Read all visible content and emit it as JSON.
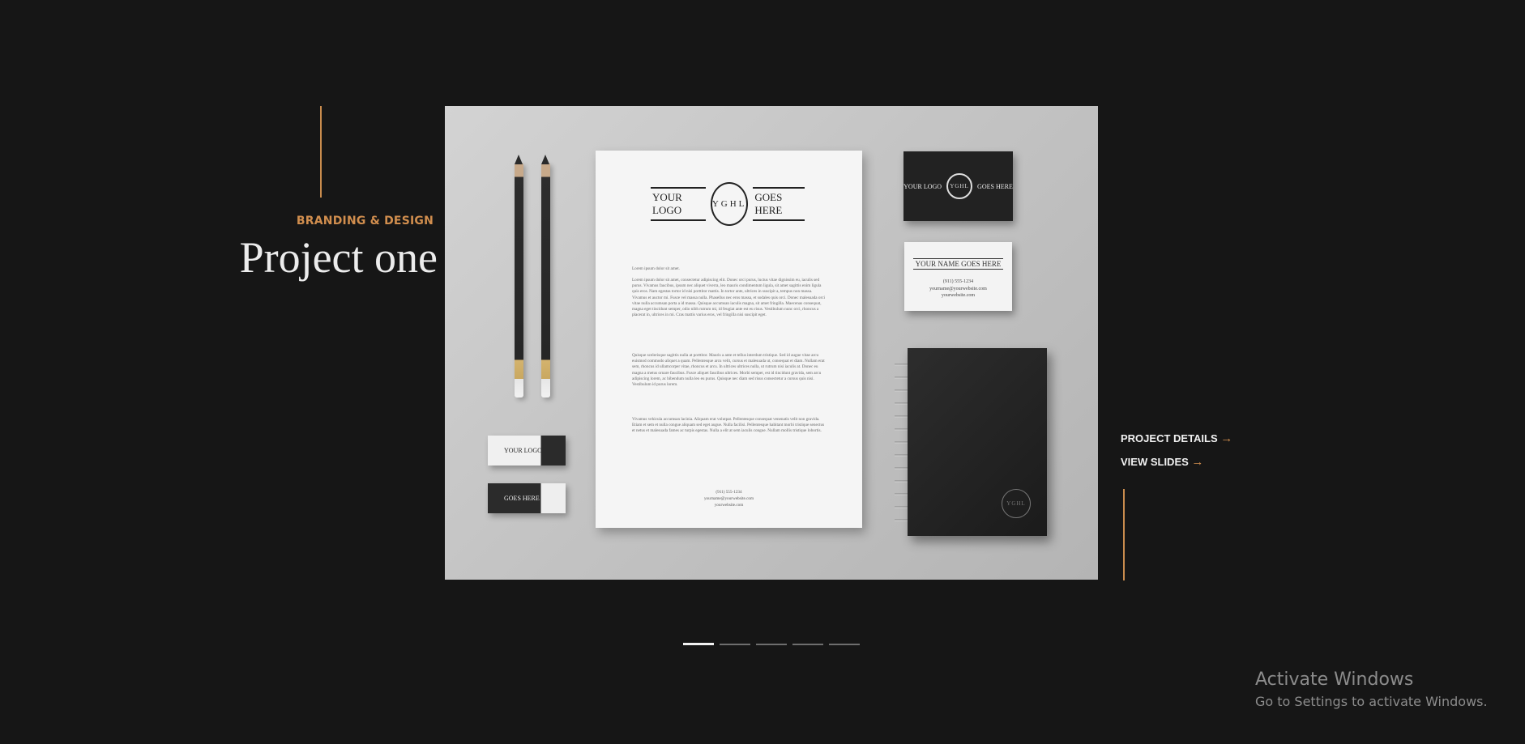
{
  "project": {
    "category": "BRANDING & DESIGN",
    "title": "Project one"
  },
  "mockup": {
    "letterhead": {
      "logo_left": "YOUR LOGO",
      "logo_right": "GOES HERE",
      "seal": "YGHL",
      "greeting": "Lorem ipsum dolor sit amet.",
      "paragraph_1": "Lorem ipsum dolor sit amet, consectetur adipiscing elit. Donec orci purus, luctus vitae dignissim eu, iaculis sed purus. Vivamus faucibus, ipsum nec aliquet viverra, leo mauris condimentum ligula, sit amet sagittis enim ligula quis eros. Nam egestas tortor id nisi porttitor mattis. In tortor ante, ultrices in suscipit a, tempus non massa. Vivamus et auctor mi. Fusce vel massa nulla. Phasellus nec eros massa, et sodales quis orci. Donec malesuada orci vitae nulla accumsan porta a id massa. Quisque accumsan iaculis magna, sit amet fringilla. Maecenas consequat, magna eget tincidunt semper, odio nibh rutrum mi, id feugiat ante est eu risus. Vestibulum nunc orci, rhoncus a placerat in, ultrices in mi. Cras mattis varius eros, vel fringilla nisi suscipit eget.",
      "paragraph_2": "Quisque scelerisque sagittis nulla at porttitor. Mauris a ante et tellus interdum tristique. Sed id augue vitae arcu euismod commodo aliquet a quam. Pellentesque arcu velit, cursus et malesuada ut, consequat et diam. Nullam erat sem, rhoncus id ullamcorper vitae, rhoncus et arcu. In ultrices ultrices nulla, ut rutrum nisi iaculis at. Donec eu magna a metus ornare faucibus. Fusce aliquet faucibus ultrices. Morbi semper, est id tincidunt gravida, sem arcu adipiscing lorem, ac bibendum nulla leo eu purus. Quisque nec diam sed risus consectetur a cursus quis nisi. Vestibulum id purus lorem.",
      "paragraph_3": "Vivamus vehicula accumsan lacinia. Aliquam erat volutpat. Pellentesque consequat venenatis velit non gravida. Etiam et sem et nulla congue aliquam sed eget augue. Nulla facilisi. Pellentesque habitant morbi tristique senectus et netus et malesuada fames ac turpis egestas. Nulla a elit at sem iaculis congue. Nullam mollis tristique lobortis.",
      "phone": "(911) 555-1234",
      "email": "yourname@yourwebsite.com",
      "website": "yourwebsite.com"
    },
    "card_black": {
      "left": "YOUR LOGO",
      "right": "GOES HERE",
      "seal": "YGHL"
    },
    "card_white": {
      "name": "YOUR NAME GOES HERE",
      "phone": "(911) 555-1234",
      "email": "yourname@yourwebsite.com",
      "website": "yourwebsite.com"
    },
    "eraser_1": "YOUR LOGO",
    "eraser_2": "GOES HERE",
    "notebook_seal": "YGHL"
  },
  "links": {
    "details": "PROJECT DETAILS",
    "slides": "VIEW SLIDES",
    "arrow": "→"
  },
  "pager": {
    "count": 5,
    "active_index": 0
  },
  "watermark": {
    "title": "Activate Windows",
    "subtitle": "Go to Settings to activate Windows."
  },
  "colors": {
    "background": "#161616",
    "accent": "#d18e4e",
    "text": "#ececec"
  }
}
